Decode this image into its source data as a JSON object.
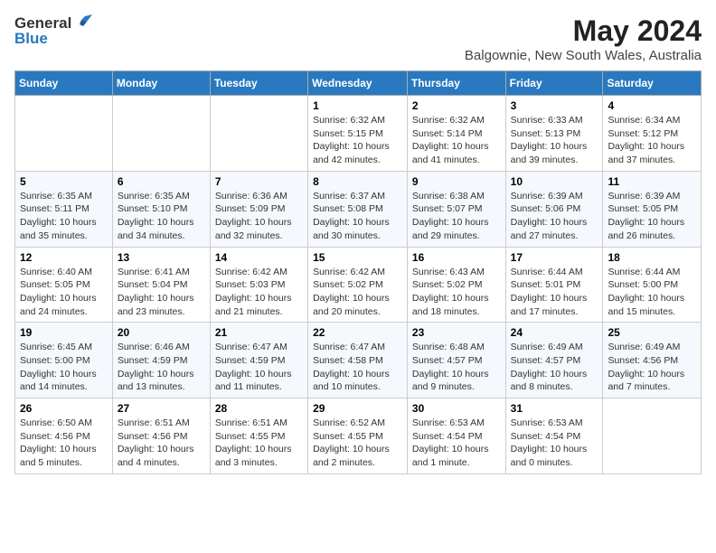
{
  "header": {
    "logo_general": "General",
    "logo_blue": "Blue",
    "main_title": "May 2024",
    "sub_title": "Balgownie, New South Wales, Australia"
  },
  "calendar": {
    "weekdays": [
      "Sunday",
      "Monday",
      "Tuesday",
      "Wednesday",
      "Thursday",
      "Friday",
      "Saturday"
    ],
    "rows": [
      [
        {
          "day": "",
          "info": ""
        },
        {
          "day": "",
          "info": ""
        },
        {
          "day": "",
          "info": ""
        },
        {
          "day": "1",
          "info": "Sunrise: 6:32 AM\nSunset: 5:15 PM\nDaylight: 10 hours\nand 42 minutes."
        },
        {
          "day": "2",
          "info": "Sunrise: 6:32 AM\nSunset: 5:14 PM\nDaylight: 10 hours\nand 41 minutes."
        },
        {
          "day": "3",
          "info": "Sunrise: 6:33 AM\nSunset: 5:13 PM\nDaylight: 10 hours\nand 39 minutes."
        },
        {
          "day": "4",
          "info": "Sunrise: 6:34 AM\nSunset: 5:12 PM\nDaylight: 10 hours\nand 37 minutes."
        }
      ],
      [
        {
          "day": "5",
          "info": "Sunrise: 6:35 AM\nSunset: 5:11 PM\nDaylight: 10 hours\nand 35 minutes."
        },
        {
          "day": "6",
          "info": "Sunrise: 6:35 AM\nSunset: 5:10 PM\nDaylight: 10 hours\nand 34 minutes."
        },
        {
          "day": "7",
          "info": "Sunrise: 6:36 AM\nSunset: 5:09 PM\nDaylight: 10 hours\nand 32 minutes."
        },
        {
          "day": "8",
          "info": "Sunrise: 6:37 AM\nSunset: 5:08 PM\nDaylight: 10 hours\nand 30 minutes."
        },
        {
          "day": "9",
          "info": "Sunrise: 6:38 AM\nSunset: 5:07 PM\nDaylight: 10 hours\nand 29 minutes."
        },
        {
          "day": "10",
          "info": "Sunrise: 6:39 AM\nSunset: 5:06 PM\nDaylight: 10 hours\nand 27 minutes."
        },
        {
          "day": "11",
          "info": "Sunrise: 6:39 AM\nSunset: 5:05 PM\nDaylight: 10 hours\nand 26 minutes."
        }
      ],
      [
        {
          "day": "12",
          "info": "Sunrise: 6:40 AM\nSunset: 5:05 PM\nDaylight: 10 hours\nand 24 minutes."
        },
        {
          "day": "13",
          "info": "Sunrise: 6:41 AM\nSunset: 5:04 PM\nDaylight: 10 hours\nand 23 minutes."
        },
        {
          "day": "14",
          "info": "Sunrise: 6:42 AM\nSunset: 5:03 PM\nDaylight: 10 hours\nand 21 minutes."
        },
        {
          "day": "15",
          "info": "Sunrise: 6:42 AM\nSunset: 5:02 PM\nDaylight: 10 hours\nand 20 minutes."
        },
        {
          "day": "16",
          "info": "Sunrise: 6:43 AM\nSunset: 5:02 PM\nDaylight: 10 hours\nand 18 minutes."
        },
        {
          "day": "17",
          "info": "Sunrise: 6:44 AM\nSunset: 5:01 PM\nDaylight: 10 hours\nand 17 minutes."
        },
        {
          "day": "18",
          "info": "Sunrise: 6:44 AM\nSunset: 5:00 PM\nDaylight: 10 hours\nand 15 minutes."
        }
      ],
      [
        {
          "day": "19",
          "info": "Sunrise: 6:45 AM\nSunset: 5:00 PM\nDaylight: 10 hours\nand 14 minutes."
        },
        {
          "day": "20",
          "info": "Sunrise: 6:46 AM\nSunset: 4:59 PM\nDaylight: 10 hours\nand 13 minutes."
        },
        {
          "day": "21",
          "info": "Sunrise: 6:47 AM\nSunset: 4:59 PM\nDaylight: 10 hours\nand 11 minutes."
        },
        {
          "day": "22",
          "info": "Sunrise: 6:47 AM\nSunset: 4:58 PM\nDaylight: 10 hours\nand 10 minutes."
        },
        {
          "day": "23",
          "info": "Sunrise: 6:48 AM\nSunset: 4:57 PM\nDaylight: 10 hours\nand 9 minutes."
        },
        {
          "day": "24",
          "info": "Sunrise: 6:49 AM\nSunset: 4:57 PM\nDaylight: 10 hours\nand 8 minutes."
        },
        {
          "day": "25",
          "info": "Sunrise: 6:49 AM\nSunset: 4:56 PM\nDaylight: 10 hours\nand 7 minutes."
        }
      ],
      [
        {
          "day": "26",
          "info": "Sunrise: 6:50 AM\nSunset: 4:56 PM\nDaylight: 10 hours\nand 5 minutes."
        },
        {
          "day": "27",
          "info": "Sunrise: 6:51 AM\nSunset: 4:56 PM\nDaylight: 10 hours\nand 4 minutes."
        },
        {
          "day": "28",
          "info": "Sunrise: 6:51 AM\nSunset: 4:55 PM\nDaylight: 10 hours\nand 3 minutes."
        },
        {
          "day": "29",
          "info": "Sunrise: 6:52 AM\nSunset: 4:55 PM\nDaylight: 10 hours\nand 2 minutes."
        },
        {
          "day": "30",
          "info": "Sunrise: 6:53 AM\nSunset: 4:54 PM\nDaylight: 10 hours\nand 1 minute."
        },
        {
          "day": "31",
          "info": "Sunrise: 6:53 AM\nSunset: 4:54 PM\nDaylight: 10 hours\nand 0 minutes."
        },
        {
          "day": "",
          "info": ""
        }
      ]
    ]
  }
}
